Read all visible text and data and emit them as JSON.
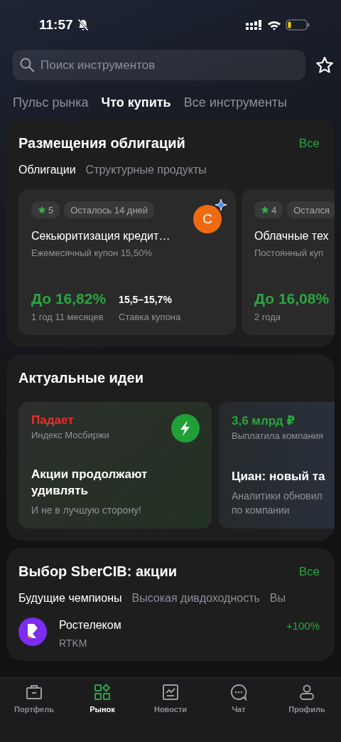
{
  "status_bar": {
    "time": "11:57"
  },
  "search": {
    "placeholder": "Поиск инструментов"
  },
  "tabs": [
    {
      "label": "Пульс рынка",
      "selected": false
    },
    {
      "label": "Что купить",
      "selected": true
    },
    {
      "label": "Все инструменты",
      "selected": false
    }
  ],
  "sections": [
    {
      "kind": "bonds",
      "title": "Размещения облигаций",
      "link": "Все",
      "subtabs": [
        {
          "label": "Облигации",
          "selected": true
        },
        {
          "label": "Структурные продукты",
          "selected": false
        }
      ],
      "cards": [
        {
          "rating": "5",
          "badge": "Осталось 14 дней",
          "avatar": "С",
          "title": "Секьюритизация кредит…",
          "subtitle": "Ежемесячный купон 15,50%",
          "yield": "До 16,82%",
          "term": "1 год 11 месяцев",
          "rate": "15,5–15,7%",
          "rate_label": "Ставка купона"
        },
        {
          "rating": "4",
          "badge": "Остался",
          "title": "Облачные тех",
          "subtitle": "Постоянный куп",
          "yield": "До 16,08%",
          "term": "2 года"
        }
      ]
    },
    {
      "kind": "ideas",
      "title": "Актуальные идеи",
      "cards": [
        {
          "kind": "lightning",
          "value": "Падает",
          "color": "#e8302c",
          "source": "Индекс Мосбиржи",
          "title": "Акции продолжают удивлять",
          "description": "И не в лучшую сторону!"
        },
        {
          "kind": "plain",
          "value": "3,6 млрд ₽",
          "color": "#2aa640",
          "source": "Выплатила компания",
          "title": "Циан: новый та",
          "description": "Аналитики обновил по компании"
        }
      ]
    },
    {
      "kind": "stocks",
      "title": "Выбор SberCIB: акции",
      "link": "Все",
      "subtabs": [
        {
          "label": "Будущие чемпионы",
          "selected": true
        },
        {
          "label": "Высокая дивдоходность",
          "selected": false
        },
        {
          "label": "Вы",
          "selected": false
        }
      ],
      "rows": [
        {
          "name": "Ростелеком",
          "ticker": "RTKM",
          "change": "+100%"
        }
      ]
    }
  ],
  "nav": [
    {
      "label": "Портфель",
      "selected": false
    },
    {
      "label": "Рынок",
      "selected": true
    },
    {
      "label": "Новости",
      "selected": false
    },
    {
      "label": "Чат",
      "selected": false
    },
    {
      "label": "Профиль",
      "selected": false
    }
  ]
}
